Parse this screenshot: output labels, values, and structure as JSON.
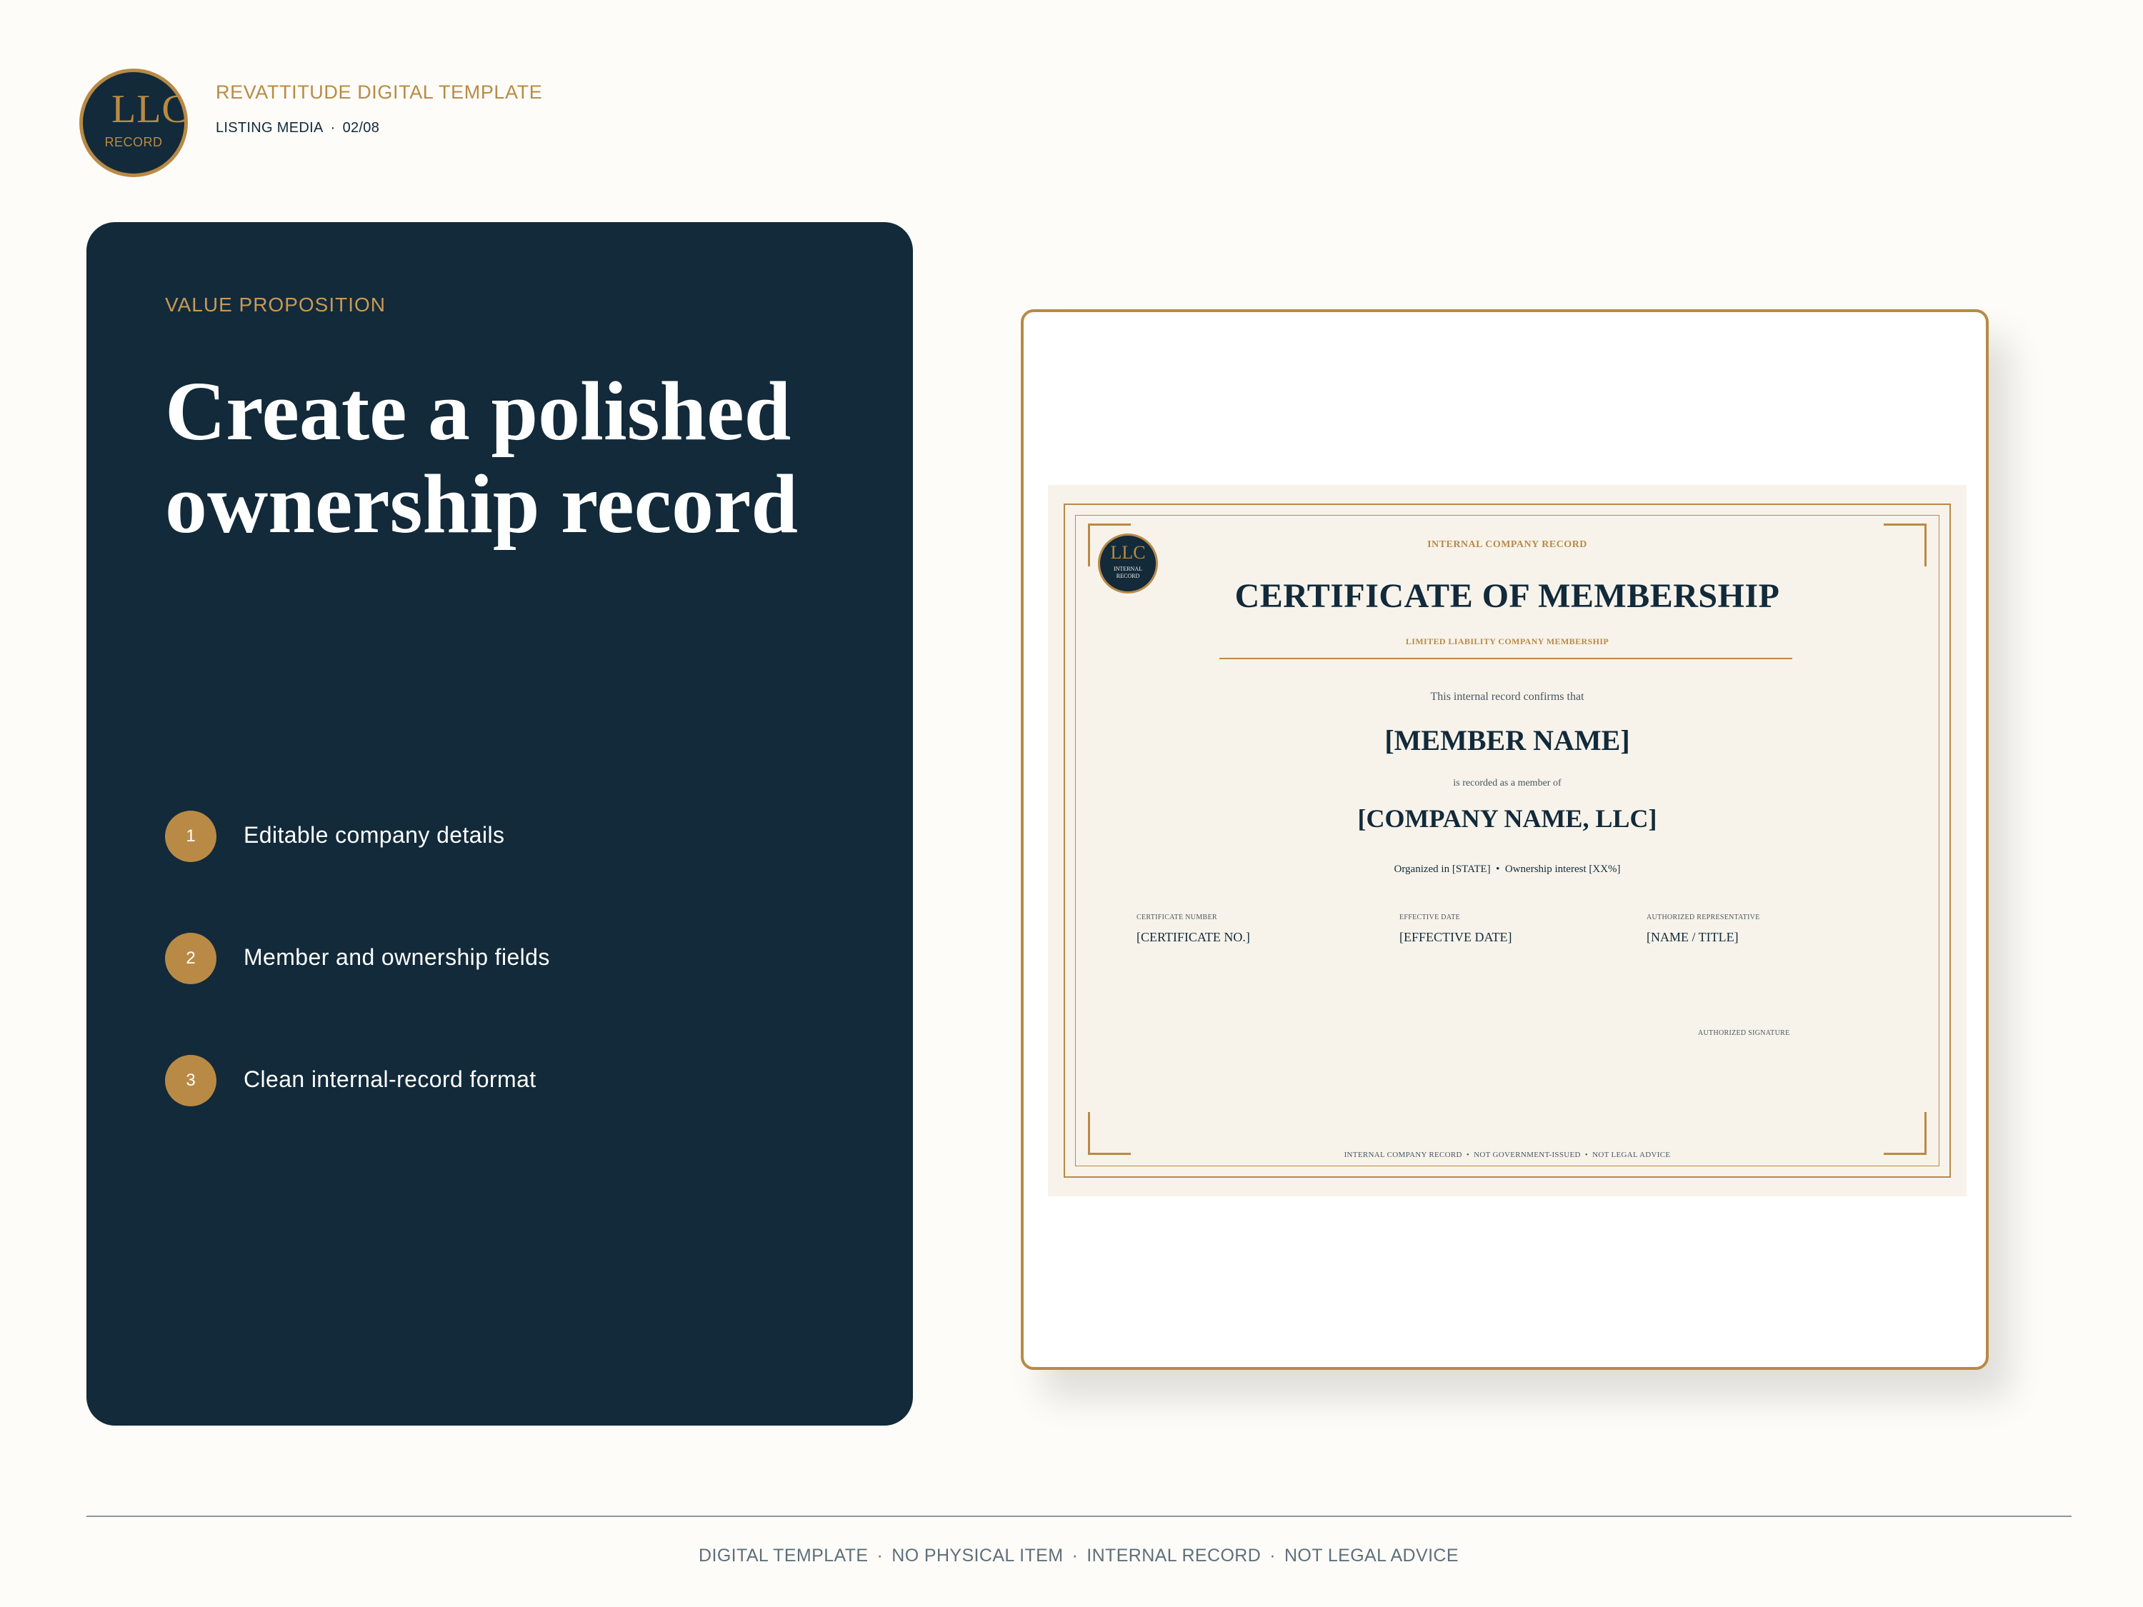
{
  "header": {
    "logo_text": "LLC",
    "logo_subtext": "RECORD",
    "brand_title": "REVATTITUDE DIGITAL TEMPLATE",
    "meta_label": "LISTING MEDIA",
    "meta_separator": "·",
    "page_counter": "02/08"
  },
  "panel": {
    "eyebrow": "VALUE PROPOSITION",
    "headline": "Create a polished ownership record",
    "features": [
      {
        "number": "1",
        "label": "Editable company details"
      },
      {
        "number": "2",
        "label": "Member and ownership fields"
      },
      {
        "number": "3",
        "label": "Clean internal-record format"
      }
    ]
  },
  "certificate": {
    "seal_text": "LLC",
    "seal_subtext": "INTERNAL RECORD",
    "kicker": "INTERNAL COMPANY RECORD",
    "title": "CERTIFICATE OF MEMBERSHIP",
    "subtitle": "LIMITED LIABILITY COMPANY MEMBERSHIP",
    "confirm_line": "This internal record confirms that",
    "member_name": "[MEMBER NAME]",
    "recorded_line": "is recorded as a member of",
    "company_name": "[COMPANY NAME, LLC]",
    "organization_line": "Organized in [STATE]  •  Ownership interest [XX%]",
    "fields": [
      {
        "label": "CERTIFICATE NUMBER",
        "value": "[CERTIFICATE NO.]"
      },
      {
        "label": "EFFECTIVE DATE",
        "value": "[EFFECTIVE DATE]"
      },
      {
        "label": "AUTHORIZED REPRESENTATIVE",
        "value": "[NAME / TITLE]"
      }
    ],
    "signature_label": "AUTHORIZED SIGNATURE",
    "footer": "INTERNAL COMPANY RECORD  •  NOT GOVERNMENT-ISSUED  •  NOT LEGAL ADVICE"
  },
  "footer": {
    "items": [
      "DIGITAL TEMPLATE",
      "NO PHYSICAL ITEM",
      "INTERNAL RECORD",
      "NOT LEGAL ADVICE"
    ],
    "separator": "·"
  },
  "colors": {
    "navy": "#122a3a",
    "gold": "#b98a45",
    "cream": "#fdfcf8",
    "certificate_paper": "#f7f3eb"
  }
}
